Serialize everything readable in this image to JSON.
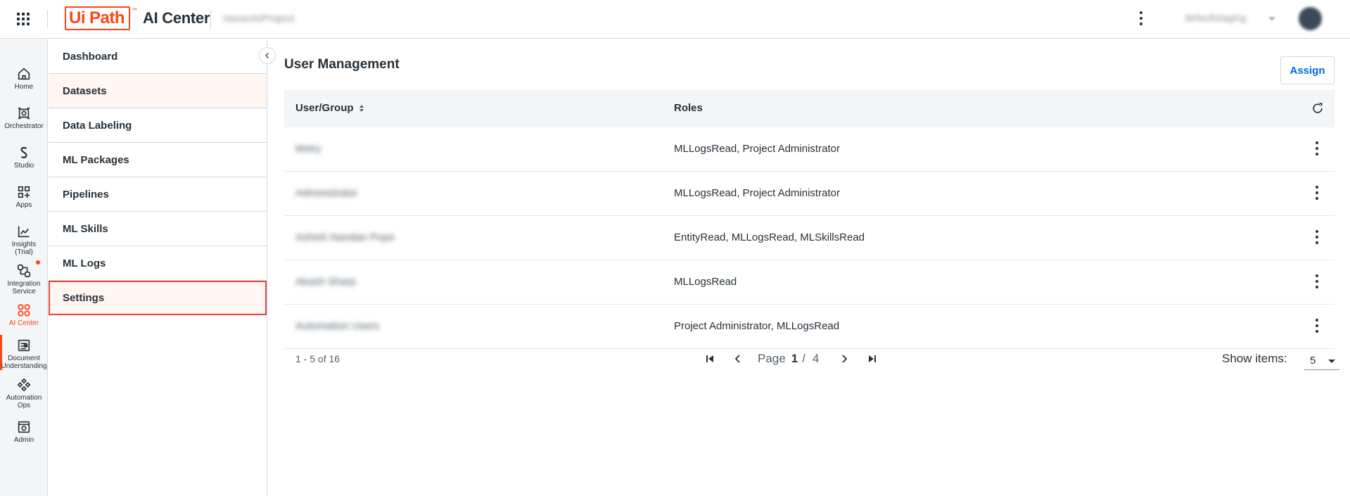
{
  "header": {
    "brand_ui": "Ui",
    "brand_path": "Path",
    "brand_tm": "™",
    "product": "AI Center",
    "project": "VasanAIProject",
    "tenant": "defaultstaging",
    "icons": {
      "launcher": "apps-grid-icon",
      "more": "more-vertical-icon"
    }
  },
  "rail": [
    {
      "label": "Home",
      "icon": "home-icon"
    },
    {
      "label": "Orchestrator",
      "icon": "orchestrator-icon"
    },
    {
      "label": "Studio",
      "icon": "studio-icon"
    },
    {
      "label": "Apps",
      "icon": "apps-icon"
    },
    {
      "label": "Insights\n(Trial)",
      "icon": "insights-icon"
    },
    {
      "label": "Integration\nService",
      "icon": "integration-icon"
    },
    {
      "label": "AI Center",
      "icon": "ai-center-icon"
    },
    {
      "label": "Document\nUnderstanding",
      "icon": "document-icon"
    },
    {
      "label": "Automation\nOps",
      "icon": "automation-ops-icon"
    },
    {
      "label": "Admin",
      "icon": "admin-icon"
    }
  ],
  "subnav": {
    "items": [
      {
        "label": "Dashboard"
      },
      {
        "label": "Datasets"
      },
      {
        "label": "Data Labeling"
      },
      {
        "label": "ML Packages"
      },
      {
        "label": "Pipelines"
      },
      {
        "label": "ML Skills"
      },
      {
        "label": "ML Logs"
      },
      {
        "label": "Settings"
      }
    ]
  },
  "main": {
    "title": "User Management",
    "assign_label": "Assign",
    "table": {
      "col_user": "User/Group",
      "col_roles": "Roles",
      "rows": [
        {
          "user": "Mstry",
          "roles": "MLLogsRead, Project Administrator"
        },
        {
          "user": "Administrator",
          "roles": "MLLogsRead, Project Administrator"
        },
        {
          "user": "Ashish Nandan Pope",
          "roles": "EntityRead, MLLogsRead, MLSkillsRead"
        },
        {
          "user": "Akash Sharp",
          "roles": "MLLogsRead"
        },
        {
          "user": "Automation Users",
          "roles": "Project Administrator, MLLogsRead"
        }
      ]
    },
    "pagination": {
      "range": "1 - 5 of 16",
      "page_label": "Page",
      "current": "1",
      "slash": "/",
      "total": "4",
      "show_items_label": "Show items:",
      "show_items_value": "5"
    }
  },
  "colors": {
    "accent": "#fa4616",
    "link": "#0067df",
    "selected_bg": "#fff5f1",
    "selected_border": "#e6453f"
  }
}
